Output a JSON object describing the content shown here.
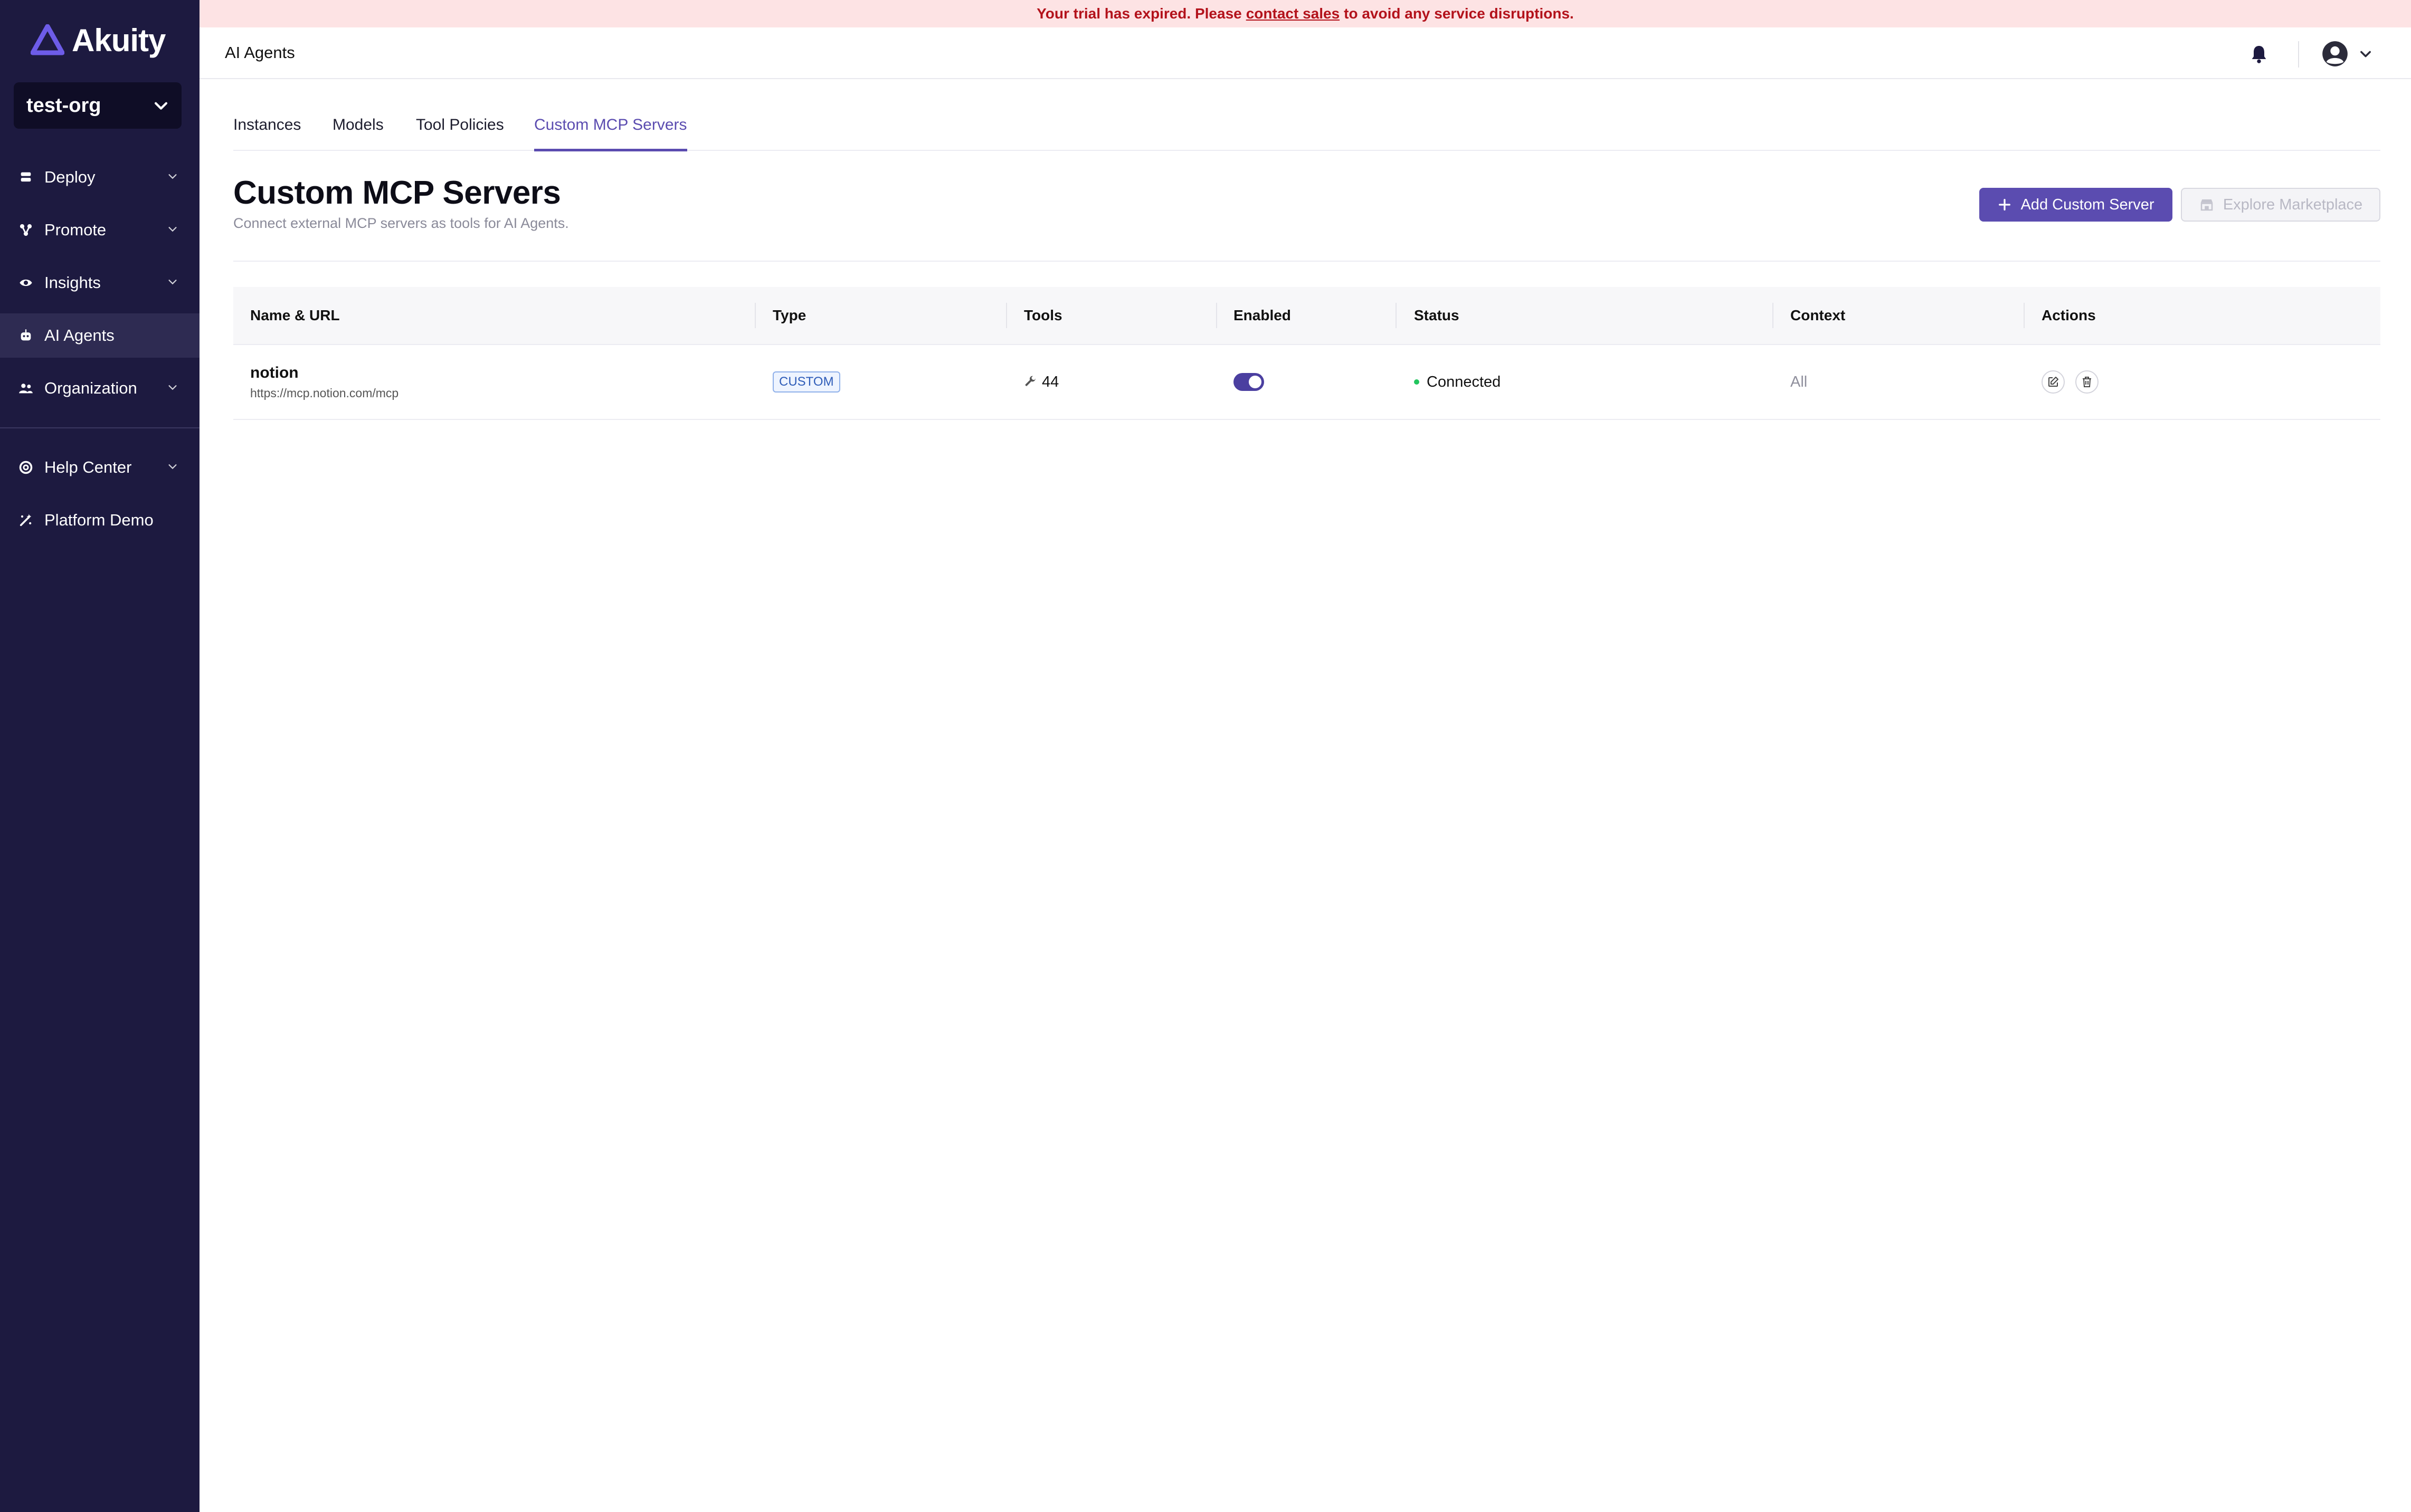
{
  "brand": {
    "name": "Akuity",
    "logo_icon": "akuity-logo-icon"
  },
  "org_selector": {
    "value": "test-org"
  },
  "sidebar": {
    "items": [
      {
        "label": "Deploy",
        "icon": "deploy-icon",
        "expandable": true
      },
      {
        "label": "Promote",
        "icon": "promote-icon",
        "expandable": true
      },
      {
        "label": "Insights",
        "icon": "insights-icon",
        "expandable": true
      },
      {
        "label": "AI Agents",
        "icon": "ai-agents-icon",
        "expandable": false,
        "active": true
      },
      {
        "label": "Organization",
        "icon": "organization-icon",
        "expandable": true
      },
      {
        "label": "Help Center",
        "icon": "help-center-icon",
        "expandable": true
      },
      {
        "label": "Platform Demo",
        "icon": "platform-demo-icon",
        "expandable": false
      }
    ]
  },
  "banner": {
    "before": "Your trial has expired. Please",
    "link": "contact sales",
    "after": "to avoid any service disruptions.",
    "color": "#b3121b"
  },
  "header": {
    "title": "AI Agents"
  },
  "tabs": [
    {
      "label": "Instances"
    },
    {
      "label": "Models"
    },
    {
      "label": "Tool Policies"
    },
    {
      "label": "Custom MCP Servers",
      "active": true
    }
  ],
  "page": {
    "title": "Custom MCP Servers",
    "subtitle": "Connect external MCP servers as tools for AI Agents.",
    "add_button": "Add Custom Server",
    "marketplace_button": "Explore Marketplace"
  },
  "table": {
    "columns": [
      "Name & URL",
      "Type",
      "Tools",
      "Enabled",
      "Status",
      "Context",
      "Actions"
    ],
    "rows": [
      {
        "name": "notion",
        "url": "https://mcp.notion.com/mcp",
        "type": "CUSTOM",
        "tools": "44",
        "enabled": true,
        "status": "Connected",
        "context": "All"
      }
    ]
  },
  "colors": {
    "accent": "#5b4cb0",
    "sidebar_bg": "#1d1a40",
    "status_connected": "#22c55e"
  }
}
